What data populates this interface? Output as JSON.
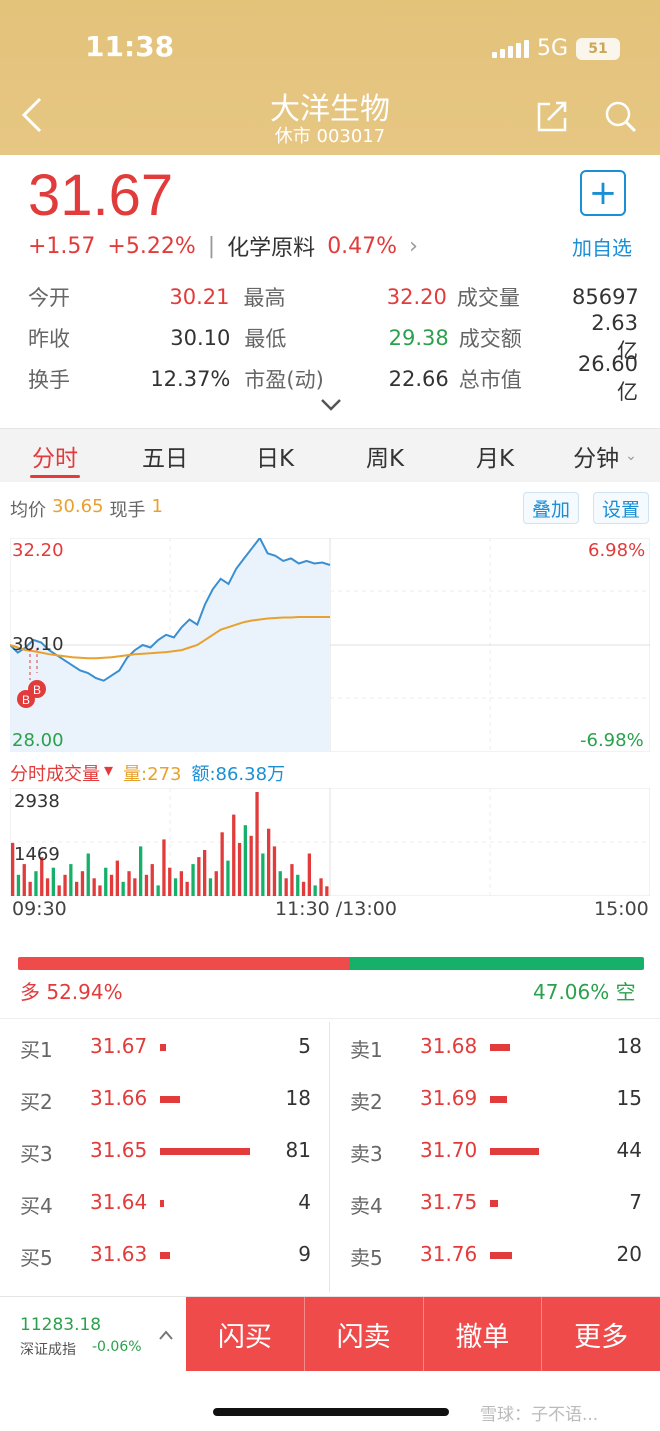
{
  "status": {
    "time": "11:38",
    "network": "5G",
    "battery": "51"
  },
  "header": {
    "title": "大洋生物",
    "subtitle": "休市 003017"
  },
  "quote": {
    "price": "31.67",
    "change": "+1.57",
    "change_pct": "+5.22%",
    "sector": "化学原料",
    "sector_pct": "0.47%",
    "add_label": "加自选"
  },
  "stats": [
    [
      {
        "label": "今开",
        "value": "30.21",
        "tone": "red"
      },
      {
        "label": "最高",
        "value": "32.20",
        "tone": "red"
      },
      {
        "label": "成交量",
        "value": "85697",
        "tone": "dark"
      }
    ],
    [
      {
        "label": "昨收",
        "value": "30.10",
        "tone": "dark"
      },
      {
        "label": "最低",
        "value": "29.38",
        "tone": "green"
      },
      {
        "label": "成交额",
        "value": "2.63亿",
        "tone": "dark"
      }
    ],
    [
      {
        "label": "换手",
        "value": "12.37%",
        "tone": "dark"
      },
      {
        "label": "市盈(动)",
        "value": "22.66",
        "tone": "dark"
      },
      {
        "label": "总市值",
        "value": "26.60亿",
        "tone": "dark"
      }
    ]
  ],
  "tabs": [
    "分时",
    "五日",
    "日K",
    "周K",
    "月K",
    "分钟"
  ],
  "chart_info": {
    "avg_label": "均价",
    "avg_value": "30.65",
    "hand_label": "现手",
    "hand_value": "1",
    "overlay_btn": "叠加",
    "settings_btn": "设置"
  },
  "price_axis": {
    "high": "32.20",
    "prev": "30.10",
    "low": "28.00",
    "high_pct": "6.98%",
    "low_pct": "-6.98%"
  },
  "markers": [
    "B",
    "B"
  ],
  "volume_head": {
    "title": "分时成交量",
    "qty": "量:273",
    "amount": "额:86.38万",
    "max": "2938",
    "mid": "1469"
  },
  "time_axis": {
    "start": "09:30",
    "mid": "11:30 /13:00",
    "end": "15:00"
  },
  "ratio": {
    "long_label": "多 52.94%",
    "short_label": "47.06% 空",
    "long_pct": 52.94
  },
  "bids": [
    {
      "name": "买1",
      "price": "31.67",
      "vol": "5"
    },
    {
      "name": "买2",
      "price": "31.66",
      "vol": "18"
    },
    {
      "name": "买3",
      "price": "31.65",
      "vol": "81"
    },
    {
      "name": "买4",
      "price": "31.64",
      "vol": "4"
    },
    {
      "name": "买5",
      "price": "31.63",
      "vol": "9"
    }
  ],
  "asks": [
    {
      "name": "卖1",
      "price": "31.68",
      "vol": "18"
    },
    {
      "name": "卖2",
      "price": "31.69",
      "vol": "15"
    },
    {
      "name": "卖3",
      "price": "31.70",
      "vol": "44"
    },
    {
      "name": "卖4",
      "price": "31.75",
      "vol": "7"
    },
    {
      "name": "卖5",
      "price": "31.76",
      "vol": "20"
    }
  ],
  "index": {
    "value": "11283.18",
    "name": "深证成指",
    "change": "-0.06%"
  },
  "actions": [
    "闪买",
    "闪卖",
    "撤单",
    "更多"
  ],
  "watermark": "雪球：子不语...",
  "chart_data": {
    "type": "line",
    "series": [
      {
        "values": [
          30.1,
          29.95,
          30.05,
          30.2,
          30.15,
          30.0,
          29.9,
          29.8,
          29.7,
          29.6,
          29.55,
          29.45,
          29.4,
          29.5,
          29.6,
          29.85,
          30.0,
          30.1,
          30.05,
          30.2,
          30.3,
          30.25,
          30.45,
          30.6,
          30.5,
          30.9,
          31.2,
          31.4,
          31.3,
          31.6,
          31.8,
          32.0,
          32.2,
          31.9,
          31.85,
          31.75,
          31.8,
          31.7,
          31.75,
          31.7,
          31.72,
          31.67
        ]
      },
      {
        "values": [
          30.1,
          30.05,
          30.0,
          29.98,
          29.95,
          29.92,
          29.9,
          29.88,
          29.86,
          29.85,
          29.84,
          29.84,
          29.85,
          29.86,
          29.88,
          29.9,
          29.92,
          29.93,
          29.94,
          29.95,
          29.96,
          29.98,
          30.0,
          30.05,
          30.1,
          30.2,
          30.3,
          30.4,
          30.45,
          30.5,
          30.55,
          30.58,
          30.6,
          30.62,
          30.63,
          30.64,
          30.64,
          30.65,
          30.65,
          30.65,
          30.65,
          30.65
        ]
      }
    ],
    "ylim": [
      28.0,
      32.2
    ],
    "volume": [
      1500,
      600,
      900,
      400,
      700,
      1100,
      500,
      800,
      300,
      600,
      900,
      400,
      700,
      1200,
      500,
      300,
      800,
      600,
      1000,
      400,
      700,
      500,
      1400,
      600,
      900,
      300,
      1600,
      800,
      500,
      700,
      400,
      900,
      1100,
      1300,
      500,
      700,
      1800,
      1000,
      2300,
      1500,
      2000,
      1700,
      2938,
      1200,
      1900,
      1400,
      700,
      500,
      900,
      600,
      400,
      1200,
      300,
      500,
      273
    ],
    "volume_max": 2938
  }
}
